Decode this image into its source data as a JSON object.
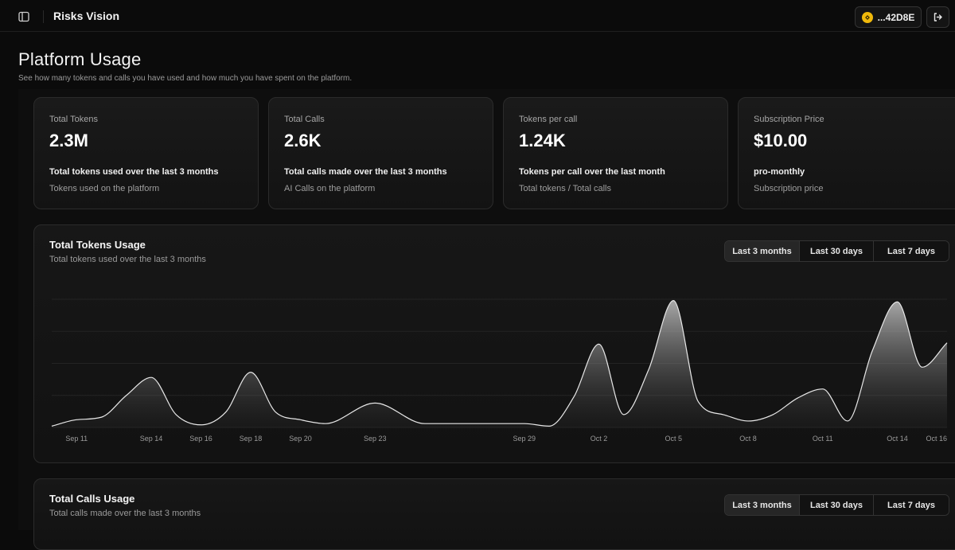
{
  "header": {
    "app_title": "Risks Vision",
    "wallet": "...42D8E",
    "icons": {
      "sidebar": "sidebar-toggle-icon",
      "wallet": "bnb-coin-icon",
      "logout": "logout-icon"
    }
  },
  "page": {
    "title": "Platform Usage",
    "subtitle": "See how many tokens and calls you have used and how much you have spent on the platform."
  },
  "stats": [
    {
      "label": "Total Tokens",
      "value": "2.3M",
      "desc": "Total tokens used over the last 3 months",
      "sub": "Tokens used on the platform"
    },
    {
      "label": "Total Calls",
      "value": "2.6K",
      "desc": "Total calls made over the last 3 months",
      "sub": "AI Calls on the platform"
    },
    {
      "label": "Tokens per call",
      "value": "1.24K",
      "desc": "Tokens per call over the last month",
      "sub": "Total tokens / Total calls"
    },
    {
      "label": "Subscription Price",
      "value": "$10.00",
      "desc": "pro-monthly",
      "sub": "Subscription price"
    }
  ],
  "tokens_card": {
    "title": "Total Tokens Usage",
    "subtitle": "Total tokens used over the last 3 months",
    "ranges": [
      "Last 3 months",
      "Last 30 days",
      "Last 7 days"
    ],
    "active_range": 0
  },
  "calls_card": {
    "title": "Total Calls Usage",
    "subtitle": "Total calls made over the last 3 months",
    "ranges": [
      "Last 3 months",
      "Last 30 days",
      "Last 7 days"
    ],
    "active_range": 0
  },
  "chart_data": {
    "type": "area",
    "title": "Total Tokens Usage",
    "xlabel": "",
    "ylabel": "",
    "ylim": [
      0,
      100
    ],
    "grid": true,
    "x_ticks": [
      "Sep 11",
      "Sep 14",
      "Sep 16",
      "Sep 18",
      "Sep 20",
      "Sep 23",
      "Sep 29",
      "Oct 2",
      "Oct 5",
      "Oct 8",
      "Oct 11",
      "Oct 14",
      "Oct 16"
    ],
    "x": [
      "Sep 10",
      "Sep 11",
      "Sep 12",
      "Sep 13",
      "Sep 14",
      "Sep 15",
      "Sep 16",
      "Sep 17",
      "Sep 18",
      "Sep 19",
      "Sep 20",
      "Sep 21",
      "Sep 23",
      "Sep 25",
      "Sep 27",
      "Sep 29",
      "Sep 30",
      "Oct 1",
      "Oct 2",
      "Oct 3",
      "Oct 4",
      "Oct 5",
      "Oct 6",
      "Oct 7",
      "Oct 8",
      "Oct 9",
      "Oct 10",
      "Oct 11",
      "Oct 12",
      "Oct 13",
      "Oct 14",
      "Oct 15",
      "Oct 16"
    ],
    "values": [
      1,
      6,
      8,
      25,
      39,
      10,
      2,
      12,
      43,
      12,
      6,
      3,
      19,
      3,
      3,
      3,
      1,
      24,
      65,
      10,
      45,
      99,
      20,
      10,
      5,
      10,
      23,
      30,
      5,
      60,
      98,
      47,
      66
    ]
  }
}
